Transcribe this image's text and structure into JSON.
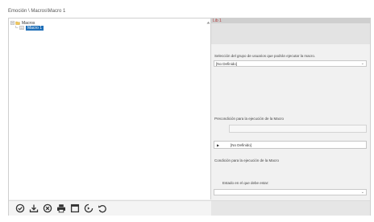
{
  "breadcrumb": "Emoción \\ Macros\\Macro 1",
  "tree": {
    "root_label": "Macros",
    "child_label": "Macro 1"
  },
  "panel": {
    "header": "Lib 1",
    "user_group_label": "Selección del grupo de usuarios que podrán ejecutar la macro.",
    "user_group_value": "[No Definido]",
    "precondition_label": "Precondición para la ejecución de la Macro",
    "precondition_row_value": "[No Definido]",
    "condition_label": "Condición para la ejecución de la Macro",
    "state_label": "Estado en el que debe estar:",
    "state_value": ""
  },
  "toolbar": {
    "icons": [
      "check-circle-icon",
      "download-icon",
      "cancel-circle-icon",
      "print-icon",
      "window-icon",
      "forward-step-icon",
      "undo-icon"
    ]
  }
}
